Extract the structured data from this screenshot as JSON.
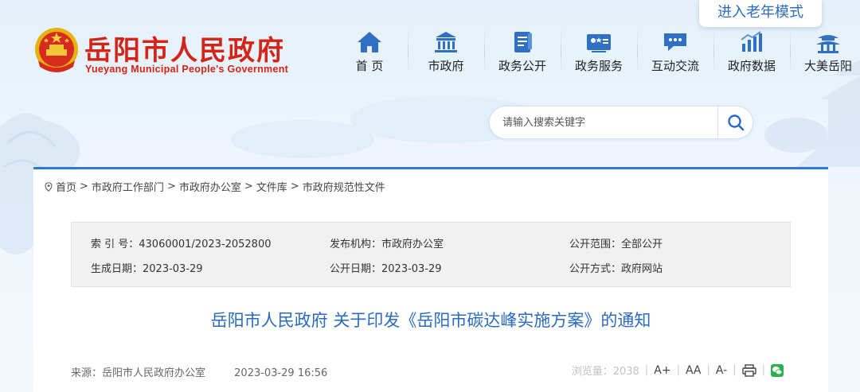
{
  "header": {
    "elder_mode": "进入老年模式",
    "logo_cn": "岳阳市人民政府",
    "logo_en": "Yueyang Municipal People's Government"
  },
  "nav": {
    "items": [
      {
        "label": "首 页",
        "icon": "home-icon"
      },
      {
        "label": "市政府",
        "icon": "government-building-icon"
      },
      {
        "label": "政务公开",
        "icon": "document-icon"
      },
      {
        "label": "政务服务",
        "icon": "service-card-icon"
      },
      {
        "label": "互动交流",
        "icon": "chat-icon"
      },
      {
        "label": "政府数据",
        "icon": "data-chart-icon"
      },
      {
        "label": "大美岳阳",
        "icon": "pavilion-icon"
      }
    ]
  },
  "search": {
    "placeholder": "请输入搜索关键字",
    "icon": "search-icon"
  },
  "breadcrumb": {
    "items": [
      "首页",
      "市政府工作部门",
      "市政府办公室",
      "文件库",
      "市政府规范性文件"
    ],
    "separator": ">"
  },
  "meta": {
    "index_no": "索  引 号：43060001/2023-2052800",
    "issuer": "发布机构：市政府办公室",
    "scope": "公开范围：全部公开",
    "created": "生成日期：2023-03-29",
    "published": "公开日期：2023-03-29",
    "method": "公开方式：政府网站"
  },
  "document": {
    "title": "岳阳市人民政府 关于印发《岳阳市碳达峰实施方案》的通知",
    "source": "来源：岳阳市人民政府办公室",
    "datetime": "2023-03-29 16:56",
    "views": "浏览量：2038",
    "tools": {
      "font_increase": "A+",
      "font_default": "AA",
      "font_decrease": "A-"
    }
  },
  "colors": {
    "accent": "#2a6bc1",
    "brand_red": "#d42317",
    "content_border": "#2f78d3"
  }
}
